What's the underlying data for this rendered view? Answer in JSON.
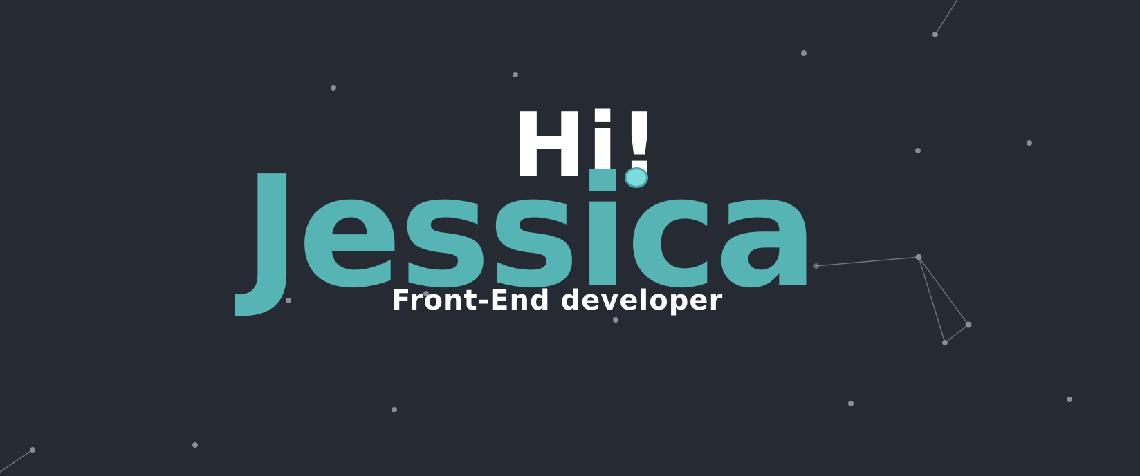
{
  "hero": {
    "greeting": "Hi!",
    "name": "Jessica",
    "role": "Front-End developer"
  },
  "theme": {
    "background": "#262a33",
    "accent": "#56b4b5",
    "text": "#ffffff",
    "particle": "#8a8d93"
  },
  "background_effect": "particle-network"
}
